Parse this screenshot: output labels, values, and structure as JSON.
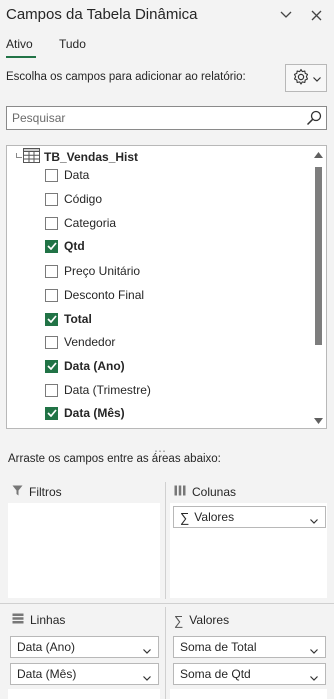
{
  "header": {
    "title": "Campos da Tabela Dinâmica",
    "tabs": [
      "Ativo",
      "Tudo"
    ]
  },
  "instruction": "Escolha os campos para adicionar ao relatório:",
  "search": {
    "placeholder": "Pesquisar",
    "value": ""
  },
  "table_name": "TB_Vendas_Hist",
  "fields": [
    {
      "label": "Data",
      "checked": false
    },
    {
      "label": "Código",
      "checked": false
    },
    {
      "label": "Categoria",
      "checked": false
    },
    {
      "label": "Qtd",
      "checked": true
    },
    {
      "label": "Preço Unitário",
      "checked": false
    },
    {
      "label": "Desconto Final",
      "checked": false
    },
    {
      "label": "Total",
      "checked": true
    },
    {
      "label": "Vendedor",
      "checked": false
    },
    {
      "label": "Data (Ano)",
      "checked": true
    },
    {
      "label": "Data (Trimestre)",
      "checked": false
    },
    {
      "label": "Data (Mês)",
      "checked": true
    }
  ],
  "drag_instruction": "Arraste os campos entre as áreas abaixo:",
  "areas": {
    "filters": {
      "label": "Filtros",
      "items": []
    },
    "columns": {
      "label": "Colunas",
      "items": [
        "Valores"
      ]
    },
    "rows": {
      "label": "Linhas",
      "items": [
        "Data (Ano)",
        "Data (Mês)"
      ]
    },
    "values": {
      "label": "Valores",
      "items": [
        "Soma de Total",
        "Soma de Qtd"
      ]
    }
  },
  "colors": {
    "accent": "#217346",
    "background": "#f3f3f3"
  }
}
